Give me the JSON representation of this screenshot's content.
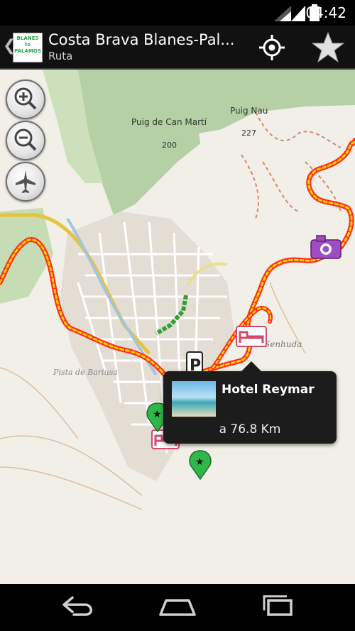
{
  "status_bar": {
    "time": "04:42"
  },
  "action_bar": {
    "title": "Costa Brava Blanes-Pal...",
    "subtitle": "Ruta",
    "logo_text": "BLANES to PALAMÓS"
  },
  "map": {
    "labels": [
      {
        "id": "puig-can-marti",
        "text": "Puig de Can Martí"
      },
      {
        "id": "elev-200",
        "text": "200"
      },
      {
        "id": "puig-nau",
        "text": "Puig Nau"
      },
      {
        "id": "elev-227",
        "text": "227"
      },
      {
        "id": "pista",
        "text": "Pista de Bariusa"
      },
      {
        "id": "cala",
        "text": "Senhuda"
      }
    ],
    "route_color": "#ff2a1a",
    "route_dash_color": "#ffd400"
  },
  "popup": {
    "name": "Hotel Reymar",
    "distance": "a 76.8 Km"
  }
}
